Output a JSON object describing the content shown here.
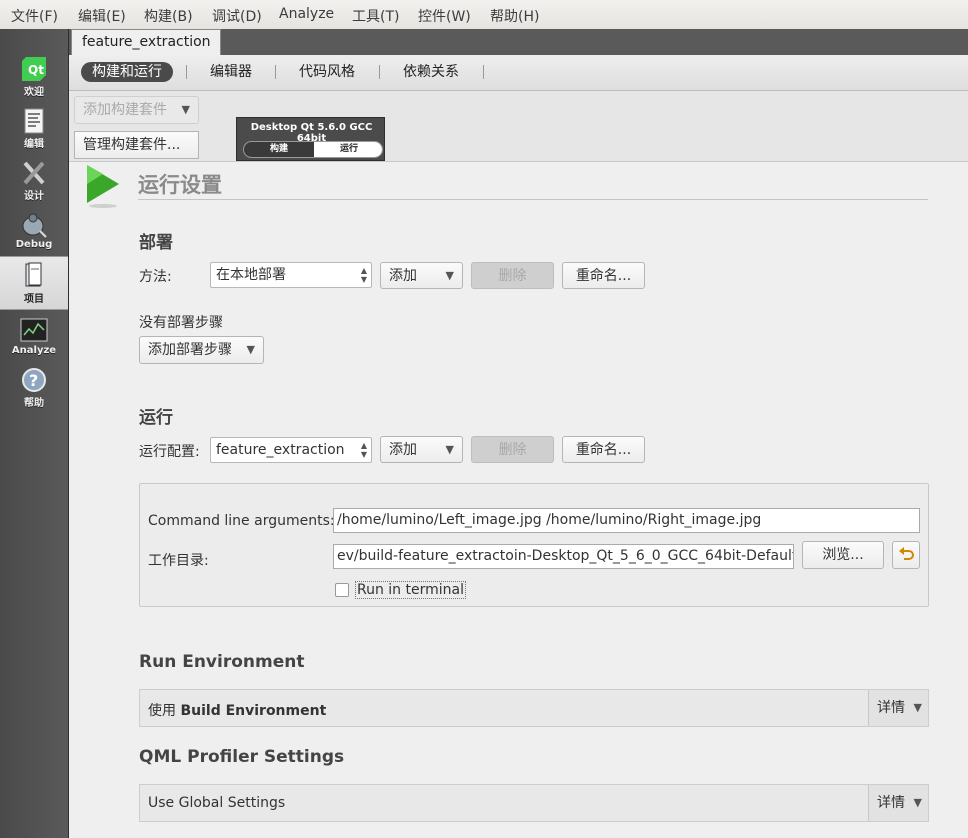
{
  "menu": [
    "文件(F)",
    "编辑(E)",
    "构建(B)",
    "调试(D)",
    "Analyze",
    "工具(T)",
    "控件(W)",
    "帮助(H)"
  ],
  "modes": [
    {
      "label": "欢迎",
      "icon": "qt-logo-icon"
    },
    {
      "label": "编辑",
      "icon": "document-edit-icon"
    },
    {
      "label": "设计",
      "icon": "design-tools-icon"
    },
    {
      "label": "Debug",
      "icon": "debug-bug-icon"
    },
    {
      "label": "项目",
      "icon": "project-wrench-icon"
    },
    {
      "label": "Analyze",
      "icon": "analyze-monitor-icon"
    },
    {
      "label": "帮助",
      "icon": "help-icon"
    }
  ],
  "project_tab": "feature_extraction",
  "subtabs": [
    "构建和运行",
    "编辑器",
    "代码风格",
    "依赖关系"
  ],
  "kit": {
    "add_kit": "添加构建套件",
    "manage_kits": "管理构建套件...",
    "name": "Desktop Qt 5.6.0 GCC 64bit",
    "build": "构建",
    "run": "运行"
  },
  "page_title": "运行设置",
  "deploy": {
    "heading": "部署",
    "method_label": "方法:",
    "method_value": "在本地部署",
    "add": "添加",
    "delete": "删除",
    "rename": "重命名...",
    "no_steps": "没有部署步骤",
    "add_step": "添加部署步骤"
  },
  "run": {
    "heading": "运行",
    "config_label": "运行配置:",
    "config_value": "feature_extraction",
    "add": "添加",
    "delete": "删除",
    "rename": "重命名...",
    "args_label": "Command line arguments:",
    "args_value": "/home/lumino/Left_image.jpg  /home/lumino/Right_image.jpg",
    "workdir_label": "工作目录:",
    "workdir_value": "ev/build-feature_extractoin-Desktop_Qt_5_6_0_GCC_64bit-Default",
    "browse": "浏览...",
    "run_in_terminal": "Run in terminal"
  },
  "run_env": {
    "heading": "Run Environment",
    "prefix": "使用",
    "value": "Build Environment",
    "details": "详情"
  },
  "qml": {
    "heading": "QML Profiler Settings",
    "value": "Use Global Settings",
    "details": "详情"
  }
}
